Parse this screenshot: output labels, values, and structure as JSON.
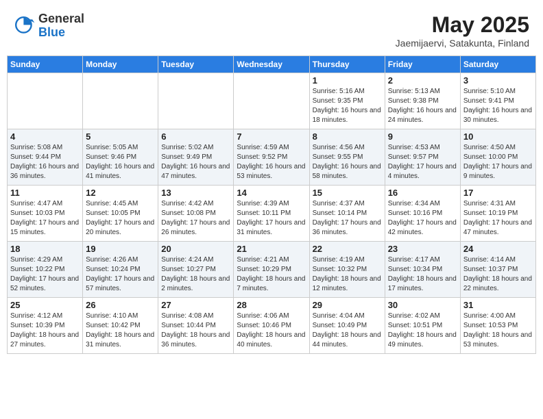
{
  "header": {
    "logo_general": "General",
    "logo_blue": "Blue",
    "title": "May 2025",
    "location": "Jaemijaervi, Satakunta, Finland"
  },
  "days_of_week": [
    "Sunday",
    "Monday",
    "Tuesday",
    "Wednesday",
    "Thursday",
    "Friday",
    "Saturday"
  ],
  "weeks": [
    [
      {
        "num": "",
        "info": ""
      },
      {
        "num": "",
        "info": ""
      },
      {
        "num": "",
        "info": ""
      },
      {
        "num": "",
        "info": ""
      },
      {
        "num": "1",
        "info": "Sunrise: 5:16 AM\nSunset: 9:35 PM\nDaylight: 16 hours and 18 minutes."
      },
      {
        "num": "2",
        "info": "Sunrise: 5:13 AM\nSunset: 9:38 PM\nDaylight: 16 hours and 24 minutes."
      },
      {
        "num": "3",
        "info": "Sunrise: 5:10 AM\nSunset: 9:41 PM\nDaylight: 16 hours and 30 minutes."
      }
    ],
    [
      {
        "num": "4",
        "info": "Sunrise: 5:08 AM\nSunset: 9:44 PM\nDaylight: 16 hours and 36 minutes."
      },
      {
        "num": "5",
        "info": "Sunrise: 5:05 AM\nSunset: 9:46 PM\nDaylight: 16 hours and 41 minutes."
      },
      {
        "num": "6",
        "info": "Sunrise: 5:02 AM\nSunset: 9:49 PM\nDaylight: 16 hours and 47 minutes."
      },
      {
        "num": "7",
        "info": "Sunrise: 4:59 AM\nSunset: 9:52 PM\nDaylight: 16 hours and 53 minutes."
      },
      {
        "num": "8",
        "info": "Sunrise: 4:56 AM\nSunset: 9:55 PM\nDaylight: 16 hours and 58 minutes."
      },
      {
        "num": "9",
        "info": "Sunrise: 4:53 AM\nSunset: 9:57 PM\nDaylight: 17 hours and 4 minutes."
      },
      {
        "num": "10",
        "info": "Sunrise: 4:50 AM\nSunset: 10:00 PM\nDaylight: 17 hours and 9 minutes."
      }
    ],
    [
      {
        "num": "11",
        "info": "Sunrise: 4:47 AM\nSunset: 10:03 PM\nDaylight: 17 hours and 15 minutes."
      },
      {
        "num": "12",
        "info": "Sunrise: 4:45 AM\nSunset: 10:05 PM\nDaylight: 17 hours and 20 minutes."
      },
      {
        "num": "13",
        "info": "Sunrise: 4:42 AM\nSunset: 10:08 PM\nDaylight: 17 hours and 26 minutes."
      },
      {
        "num": "14",
        "info": "Sunrise: 4:39 AM\nSunset: 10:11 PM\nDaylight: 17 hours and 31 minutes."
      },
      {
        "num": "15",
        "info": "Sunrise: 4:37 AM\nSunset: 10:14 PM\nDaylight: 17 hours and 36 minutes."
      },
      {
        "num": "16",
        "info": "Sunrise: 4:34 AM\nSunset: 10:16 PM\nDaylight: 17 hours and 42 minutes."
      },
      {
        "num": "17",
        "info": "Sunrise: 4:31 AM\nSunset: 10:19 PM\nDaylight: 17 hours and 47 minutes."
      }
    ],
    [
      {
        "num": "18",
        "info": "Sunrise: 4:29 AM\nSunset: 10:22 PM\nDaylight: 17 hours and 52 minutes."
      },
      {
        "num": "19",
        "info": "Sunrise: 4:26 AM\nSunset: 10:24 PM\nDaylight: 17 hours and 57 minutes."
      },
      {
        "num": "20",
        "info": "Sunrise: 4:24 AM\nSunset: 10:27 PM\nDaylight: 18 hours and 2 minutes."
      },
      {
        "num": "21",
        "info": "Sunrise: 4:21 AM\nSunset: 10:29 PM\nDaylight: 18 hours and 7 minutes."
      },
      {
        "num": "22",
        "info": "Sunrise: 4:19 AM\nSunset: 10:32 PM\nDaylight: 18 hours and 12 minutes."
      },
      {
        "num": "23",
        "info": "Sunrise: 4:17 AM\nSunset: 10:34 PM\nDaylight: 18 hours and 17 minutes."
      },
      {
        "num": "24",
        "info": "Sunrise: 4:14 AM\nSunset: 10:37 PM\nDaylight: 18 hours and 22 minutes."
      }
    ],
    [
      {
        "num": "25",
        "info": "Sunrise: 4:12 AM\nSunset: 10:39 PM\nDaylight: 18 hours and 27 minutes."
      },
      {
        "num": "26",
        "info": "Sunrise: 4:10 AM\nSunset: 10:42 PM\nDaylight: 18 hours and 31 minutes."
      },
      {
        "num": "27",
        "info": "Sunrise: 4:08 AM\nSunset: 10:44 PM\nDaylight: 18 hours and 36 minutes."
      },
      {
        "num": "28",
        "info": "Sunrise: 4:06 AM\nSunset: 10:46 PM\nDaylight: 18 hours and 40 minutes."
      },
      {
        "num": "29",
        "info": "Sunrise: 4:04 AM\nSunset: 10:49 PM\nDaylight: 18 hours and 44 minutes."
      },
      {
        "num": "30",
        "info": "Sunrise: 4:02 AM\nSunset: 10:51 PM\nDaylight: 18 hours and 49 minutes."
      },
      {
        "num": "31",
        "info": "Sunrise: 4:00 AM\nSunset: 10:53 PM\nDaylight: 18 hours and 53 minutes."
      }
    ]
  ]
}
